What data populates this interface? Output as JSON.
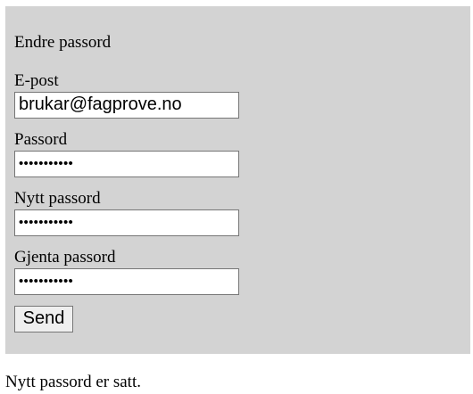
{
  "form": {
    "title": "Endre passord",
    "email_label": "E-post",
    "email_value": "brukar@fagprove.no",
    "password_label": "Passord",
    "password_value": "•••••••••••",
    "new_password_label": "Nytt passord",
    "new_password_value": "•••••••••••",
    "repeat_password_label": "Gjenta passord",
    "repeat_password_value": "•••••••••••",
    "submit_label": "Send"
  },
  "status": {
    "message": "Nytt passord er satt."
  },
  "colors": {
    "panel_background": "#d3d3d3",
    "page_background": "#ffffff"
  }
}
